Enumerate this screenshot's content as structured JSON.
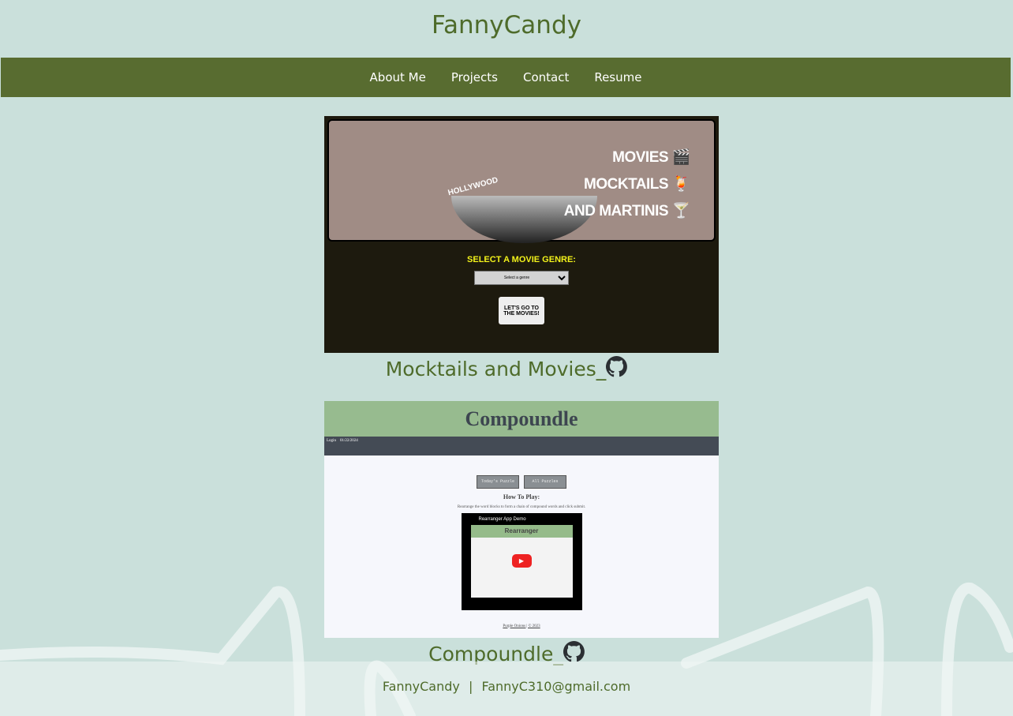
{
  "brand": "FannyCandy",
  "nav": [
    "About Me",
    "Projects",
    "Contact",
    "Resume"
  ],
  "projects": [
    {
      "title": "Mocktails and Movies_",
      "screenshot": {
        "words": [
          "MOVIES 🎬",
          "MOCKTAILS 🍹",
          "AND MARTINIS 🍸"
        ],
        "sign": "HOLLYWOOD",
        "label": "SELECT A MOVIE GENRE:",
        "select": "Select a genre",
        "button": "LET'S GO TO THE MOVIES!"
      }
    },
    {
      "title": "Compoundle_",
      "screenshot": {
        "heading": "Compoundle",
        "login": "Login",
        "date": "01/22/2024",
        "btn1": "Today's Puzzle",
        "btn2": "All Puzzles",
        "how": "How To Play:",
        "desc": "Rearrange the word blocks to form a chain of compound words and click submit.",
        "video_title": "Rearranger App Demo",
        "video_app": "Rearranger",
        "footer": "Purple Onions | © 2023"
      }
    }
  ],
  "footer": {
    "name": "FannyCandy",
    "sep": "|",
    "email": "FannyC310@gmail.com"
  }
}
